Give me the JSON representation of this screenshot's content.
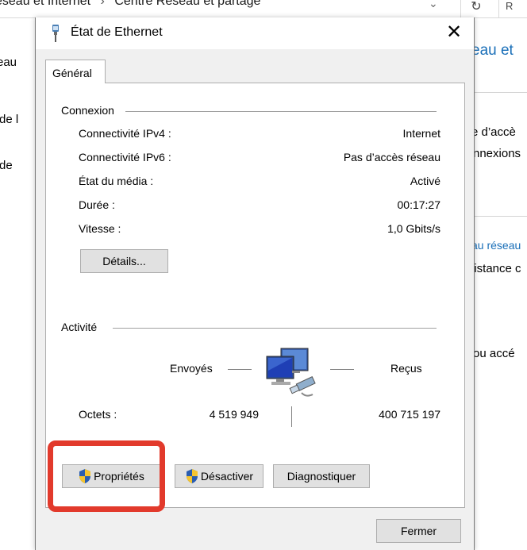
{
  "background_window": {
    "breadcrumb": [
      "éseau et Internet",
      "Centre Réseau et partage"
    ],
    "breadcrumb_separator": "›",
    "dropdown_icon": "chevron-down-icon",
    "refresh_icon": "refresh-icon",
    "search_partial": "R",
    "left_items": [
      "eau",
      "de l",
      "de"
    ],
    "right_heading": "eau et",
    "right_text_1": "e d’accè",
    "right_text_2": "nnexions",
    "right_link": "au réseau",
    "right_text_3": "listance c",
    "right_text_4": "ou accé"
  },
  "dialog": {
    "title": "État de Ethernet",
    "close_label": "✕",
    "tab_label": "Général",
    "connexion": {
      "label": "Connexion",
      "rows": [
        {
          "label": "Connectivité IPv4 :",
          "value": "Internet"
        },
        {
          "label": "Connectivité IPv6 :",
          "value": "Pas d’accès réseau"
        },
        {
          "label": "État du média :",
          "value": "Activé"
        },
        {
          "label": "Durée :",
          "value": "00:17:27"
        },
        {
          "label": "Vitesse :",
          "value": "1,0 Gbits/s"
        }
      ],
      "details_button": "Détails..."
    },
    "activite": {
      "label": "Activité",
      "sent_label": "Envoyés",
      "received_label": "Reçus",
      "octets_label": "Octets :",
      "octets_sent": "4 519 949",
      "octets_received": "400 715 197"
    },
    "buttons": {
      "properties": "Propriétés",
      "disable": "Désactiver",
      "diagnose": "Diagnostiquer",
      "close": "Fermer"
    }
  },
  "annotation_color": "#e23a2c"
}
